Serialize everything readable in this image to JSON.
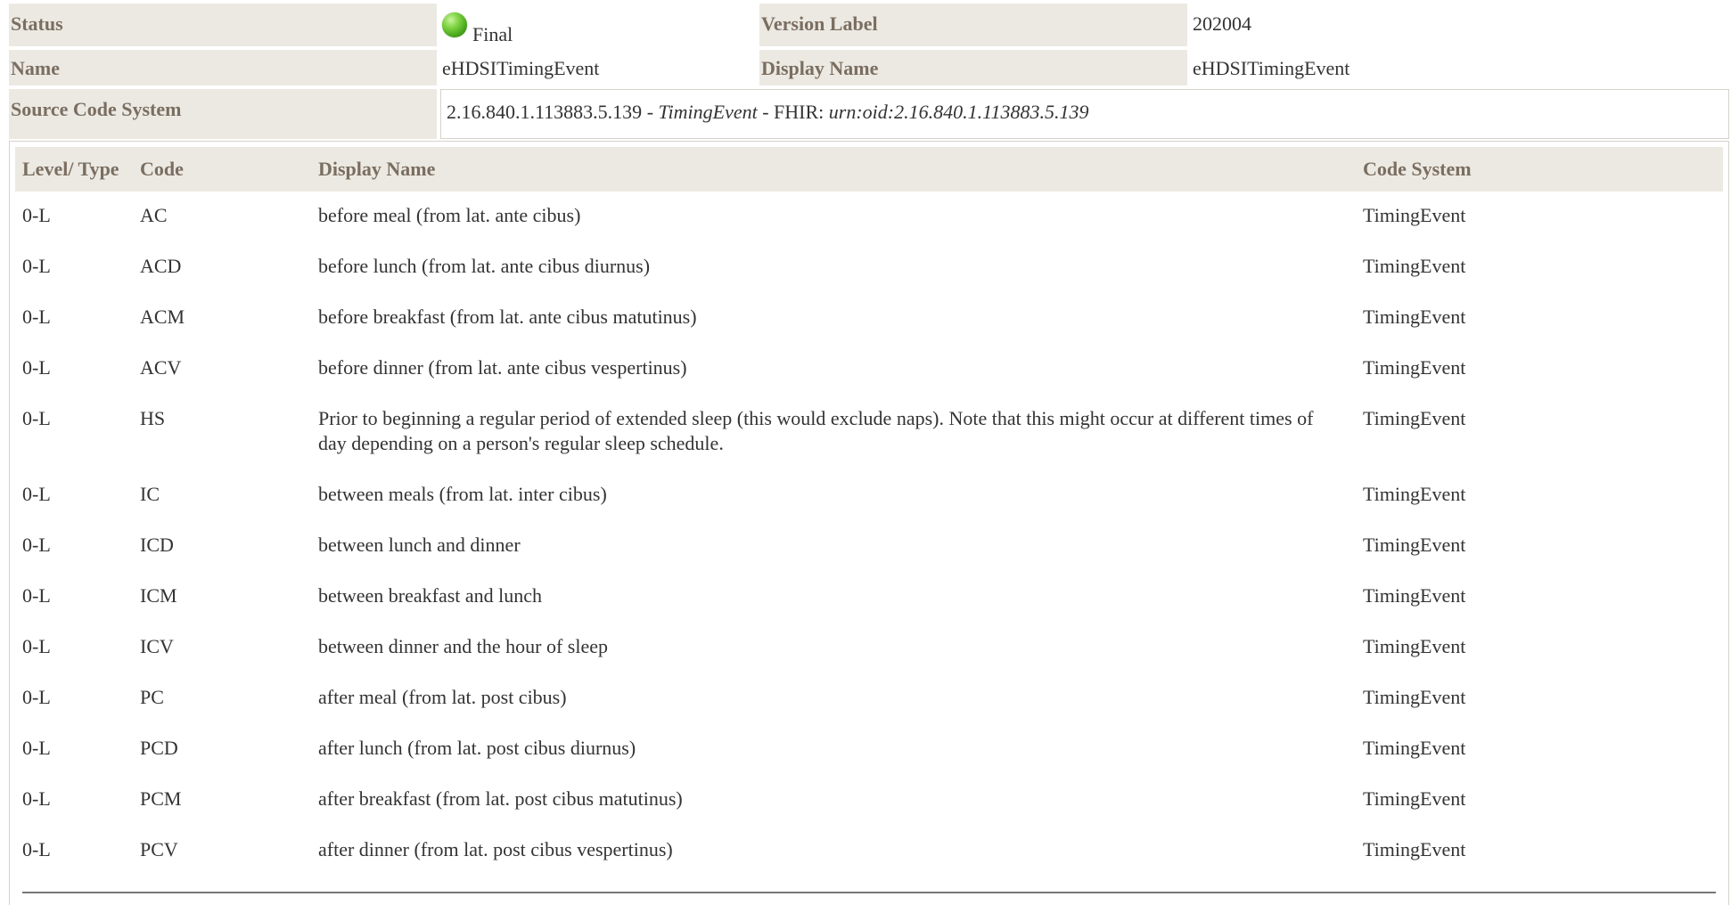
{
  "meta": {
    "status_label": "Status",
    "status_value": "Final",
    "status_icon": "green-circle-icon",
    "version_label": "Version Label",
    "version_value": "202004",
    "name_label": "Name",
    "name_value": "eHDSITimingEvent",
    "display_name_label": "Display Name",
    "display_name_value": "eHDSITimingEvent",
    "source_code_system_label": "Source Code System",
    "source_oid": "2.16.840.1.113883.5.139",
    "source_sep1": " - ",
    "source_name": "TimingEvent",
    "source_sep2": " - FHIR: ",
    "source_fhir": "urn:oid:2.16.840.1.113883.5.139"
  },
  "table": {
    "headers": {
      "level_type": "Level/ Type",
      "code": "Code",
      "display_name": "Display Name",
      "code_system": "Code System"
    },
    "rows": [
      {
        "level": "0-L",
        "code": "AC",
        "display": "before meal (from lat. ante cibus)",
        "system": "TimingEvent"
      },
      {
        "level": "0-L",
        "code": "ACD",
        "display": "before lunch (from lat. ante cibus diurnus)",
        "system": "TimingEvent"
      },
      {
        "level": "0-L",
        "code": "ACM",
        "display": "before breakfast (from lat. ante cibus matutinus)",
        "system": "TimingEvent"
      },
      {
        "level": "0-L",
        "code": "ACV",
        "display": "before dinner (from lat. ante cibus vespertinus)",
        "system": "TimingEvent"
      },
      {
        "level": "0-L",
        "code": "HS",
        "display": "Prior to beginning a regular period of extended sleep (this would exclude naps). Note that this might occur at different times of day depending on a person's regular sleep schedule.",
        "system": "TimingEvent"
      },
      {
        "level": "0-L",
        "code": "IC",
        "display": "between meals (from lat. inter cibus)",
        "system": "TimingEvent"
      },
      {
        "level": "0-L",
        "code": "ICD",
        "display": "between lunch and dinner",
        "system": "TimingEvent"
      },
      {
        "level": "0-L",
        "code": "ICM",
        "display": "between breakfast and lunch",
        "system": "TimingEvent"
      },
      {
        "level": "0-L",
        "code": "ICV",
        "display": "between dinner and the hour of sleep",
        "system": "TimingEvent"
      },
      {
        "level": "0-L",
        "code": "PC",
        "display": "after meal (from lat. post cibus)",
        "system": "TimingEvent"
      },
      {
        "level": "0-L",
        "code": "PCD",
        "display": "after lunch (from lat. post cibus diurnus)",
        "system": "TimingEvent"
      },
      {
        "level": "0-L",
        "code": "PCM",
        "display": "after breakfast (from lat. post cibus matutinus)",
        "system": "TimingEvent"
      },
      {
        "level": "0-L",
        "code": "PCV",
        "display": "after dinner (from lat. post cibus vespertinus)",
        "system": "TimingEvent"
      }
    ]
  }
}
